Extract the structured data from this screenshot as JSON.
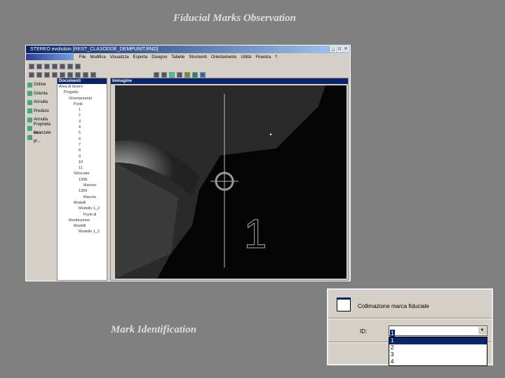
{
  "slide": {
    "title": "Fiducial Marks Observation",
    "subtitle": "Mark Identification"
  },
  "window": {
    "title": "STEREO evolution  [REST_CLASODDE_DEMPUNIT.RND]",
    "menu": [
      "File",
      "Modifica",
      "Visualizza",
      "Esporta",
      "Disegno",
      "Tabelle",
      "Strumenti",
      "Orientamento",
      "Utilità",
      "Finestra",
      "?"
    ],
    "sidebar": [
      "Online",
      "Orienta",
      "Annulla",
      "Predicto",
      "Annulla",
      "Proprietà ca...",
      "Avanzate pr..."
    ],
    "documents_panel": {
      "title": "Documenti",
      "tree": [
        {
          "label": "Area di lavoro",
          "depth": 0
        },
        {
          "label": "Progetto",
          "depth": 1
        },
        {
          "label": "Orientamento",
          "depth": 2
        },
        {
          "label": "Punti",
          "depth": 3
        },
        {
          "label": "1",
          "depth": 4
        },
        {
          "label": "2",
          "depth": 4
        },
        {
          "label": "3",
          "depth": 4
        },
        {
          "label": "4",
          "depth": 4
        },
        {
          "label": "5",
          "depth": 4
        },
        {
          "label": "6",
          "depth": 4
        },
        {
          "label": "7",
          "depth": 4
        },
        {
          "label": "8",
          "depth": 4
        },
        {
          "label": "9",
          "depth": 4
        },
        {
          "label": "10",
          "depth": 4
        },
        {
          "label": "11",
          "depth": 4
        },
        {
          "label": "Strisciate",
          "depth": 3
        },
        {
          "label": "1398",
          "depth": 4
        },
        {
          "label": "Marche",
          "depth": 5
        },
        {
          "label": "1399",
          "depth": 4
        },
        {
          "label": "Marche",
          "depth": 5
        },
        {
          "label": "Modelli",
          "depth": 3
        },
        {
          "label": "Modello 1_2",
          "depth": 4
        },
        {
          "label": "Punti di",
          "depth": 5
        },
        {
          "label": "Restituzione",
          "depth": 2
        },
        {
          "label": "Modelli",
          "depth": 3
        },
        {
          "label": "Modello 1_2",
          "depth": 4
        }
      ]
    },
    "image_panel": {
      "title": "Immagine",
      "mark_label": "1"
    }
  },
  "dialog": {
    "title": "Collimazione marca fiduciale",
    "id_label": "ID:",
    "selected": "1",
    "options": [
      "1",
      "2",
      "3",
      "4"
    ]
  }
}
